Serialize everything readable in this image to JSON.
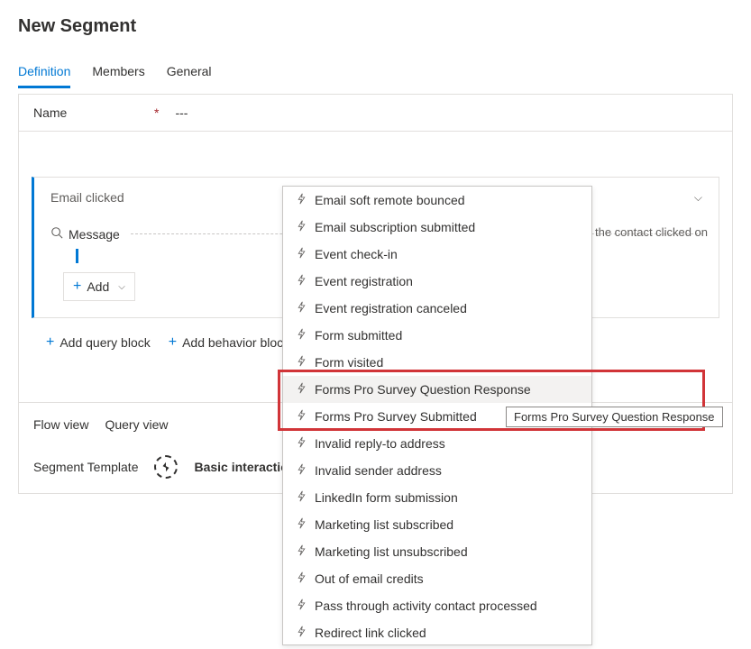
{
  "page_title": "New Segment",
  "tabs": [
    {
      "label": "Definition",
      "active": true
    },
    {
      "label": "Members",
      "active": false
    },
    {
      "label": "General",
      "active": false
    }
  ],
  "name_field": {
    "label": "Name",
    "required_marker": "*",
    "value": "---"
  },
  "block": {
    "title": "Email clicked",
    "condition_label": "Message",
    "hint": "ail that the contact clicked on",
    "add_label": "Add"
  },
  "actions": {
    "add_query_block": "Add query block",
    "add_behavior_block": "Add behavior block"
  },
  "views": {
    "flow": "Flow view",
    "query": "Query view"
  },
  "template": {
    "label": "Segment Template",
    "value": "Basic interaction"
  },
  "dropdown_items": [
    "Email soft remote bounced",
    "Email subscription submitted",
    "Event check-in",
    "Event registration",
    "Event registration canceled",
    "Form submitted",
    "Form visited",
    "Forms Pro Survey Question Response",
    "Forms Pro Survey Submitted",
    "Invalid reply-to address",
    "Invalid sender address",
    "LinkedIn form submission",
    "Marketing list subscribed",
    "Marketing list unsubscribed",
    "Out of email credits",
    "Pass through activity contact processed",
    "Redirect link clicked"
  ],
  "dropdown_hovered_index": 7,
  "tooltip_text": "Forms Pro Survey Question Response"
}
